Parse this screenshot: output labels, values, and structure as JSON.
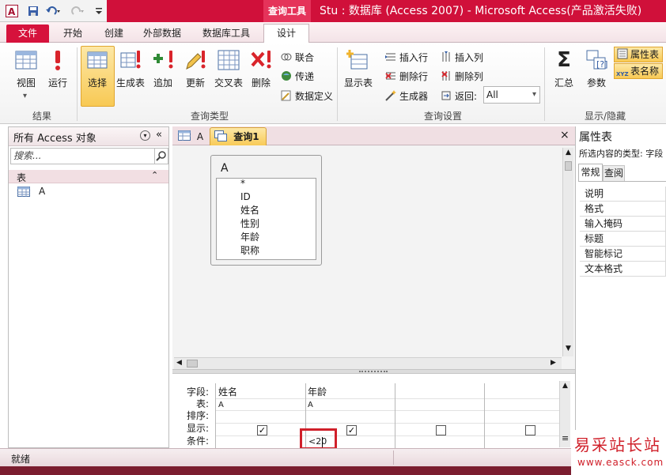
{
  "titlebar": {
    "context_tab": "查询工具",
    "title": "Stu : 数据库 (Access 2007) - Microsoft Access(产品激活失败)"
  },
  "tabs": [
    {
      "label": "文件"
    },
    {
      "label": "开始"
    },
    {
      "label": "创建"
    },
    {
      "label": "外部数据"
    },
    {
      "label": "数据库工具"
    },
    {
      "label": "设计"
    }
  ],
  "ribbon": {
    "groups": {
      "results": "结果",
      "query_type": "查询类型",
      "query_setup": "查询设置",
      "show_hide": "显示/隐藏"
    },
    "view": "视图",
    "run": "运行",
    "select": "选择",
    "make_table": "生成表",
    "append": "追加",
    "update": "更新",
    "crosstab": "交叉表",
    "delete": "删除",
    "union": "联合",
    "passthrough": "传递",
    "data_definition": "数据定义",
    "show_table": "显示表",
    "insert_rows": "插入行",
    "delete_rows": "删除行",
    "builder": "生成器",
    "insert_cols": "插入列",
    "delete_cols": "删除列",
    "return_label": "返回:",
    "return_value": "All",
    "totals": "汇总",
    "parameters": "参数",
    "property_sheet": "属性表",
    "table_names": "表名称",
    "sigma": "Σ",
    "xyz": "XYZ"
  },
  "nav": {
    "header": "所有 Access 对象",
    "search_placeholder": "搜索...",
    "category": "表",
    "items": [
      {
        "label": "A"
      }
    ]
  },
  "doc_tabs": [
    {
      "label": "A"
    },
    {
      "label": "查询1"
    }
  ],
  "query_table": {
    "name": "A",
    "fields": [
      "*",
      "ID",
      "姓名",
      "性别",
      "年龄",
      "职称"
    ]
  },
  "grid": {
    "row_labels": [
      "字段:",
      "表:",
      "排序:",
      "显示:",
      "条件:"
    ],
    "columns": [
      {
        "field": "姓名",
        "table": "A",
        "show": true,
        "criteria": ""
      },
      {
        "field": "年龄",
        "table": "A",
        "show": true,
        "criteria": "<20"
      },
      {
        "field": "",
        "table": "",
        "show": false,
        "criteria": ""
      },
      {
        "field": "",
        "table": "",
        "show": false,
        "criteria": ""
      }
    ]
  },
  "property_sheet": {
    "title": "属性表",
    "selection_type": "所选内容的类型: 字段",
    "tabs": [
      "常规",
      "查阅"
    ],
    "rows": [
      "说明",
      "格式",
      "输入掩码",
      "标题",
      "智能标记",
      "文本格式"
    ]
  },
  "status": {
    "text": "就绪"
  },
  "watermark": {
    "line1": "易采站长站",
    "line2": "www.easck.com"
  },
  "colors": {
    "brand": "#d0103a",
    "accent_select": "#fbd86d",
    "highlight_box": "#d0202a"
  }
}
